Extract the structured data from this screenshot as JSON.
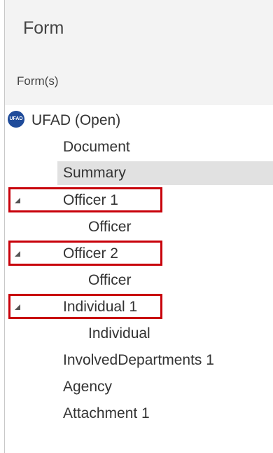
{
  "panel": {
    "title": "Form",
    "subheader": "Form(s)"
  },
  "tree": {
    "root": {
      "icon": "ufad-logo-icon",
      "icon_text": "UFAD",
      "label": "UFAD (Open)"
    },
    "items": [
      {
        "label": "Document"
      },
      {
        "label": "Summary",
        "selected": true
      },
      {
        "label": "Officer 1",
        "expanded": true,
        "highlighted": true
      },
      {
        "label": "Officer"
      },
      {
        "label": "Officer 2",
        "expanded": true,
        "highlighted": true
      },
      {
        "label": "Officer"
      },
      {
        "label": "Individual 1",
        "expanded": true,
        "highlighted": true
      },
      {
        "label": "Individual"
      },
      {
        "label": "InvolvedDepartments 1"
      },
      {
        "label": "Agency"
      },
      {
        "label": "Attachment 1"
      }
    ]
  },
  "colors": {
    "highlight": "#c8000a",
    "selected_row": "#e1e1e1",
    "header_bg": "#f3f3f3",
    "icon_blue": "#1f4b9a"
  }
}
